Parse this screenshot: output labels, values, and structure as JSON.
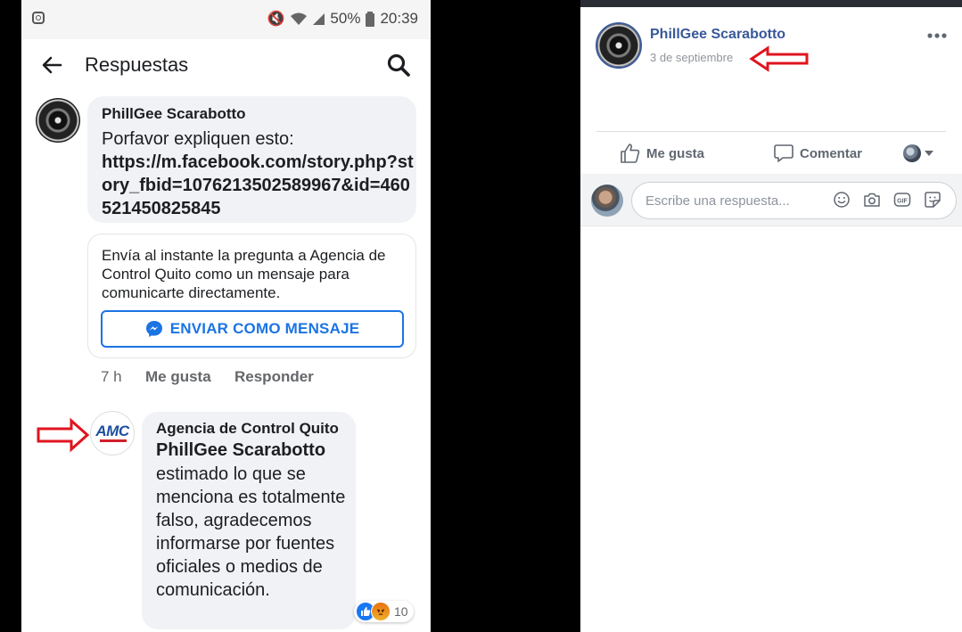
{
  "mobile": {
    "status_bar": {
      "battery": "50%",
      "time": "20:39"
    },
    "app_bar": {
      "title": "Respuestas"
    },
    "comment1": {
      "author": "PhillGee Scarabotto",
      "text": "Porfavor expliquen esto:",
      "link": "https://m.facebook.com/story.php?story_fbid=1076213502589967&id=460521450825845",
      "time": "7 h",
      "like_label": "Me gusta",
      "reply_label": "Responder"
    },
    "ask_card": {
      "text": "Envía al instante la pregunta a Agencia de Control Quito como un mensaje para comunicarte directamente.",
      "button_label": "ENVIAR COMO MENSAJE"
    },
    "comment2": {
      "avatar_text": "AMC",
      "author": "Agencia de Control Quito",
      "mention": "PhillGee Scarabotto",
      "text": "estimado lo que se menciona es totalmente falso, agradecemos informarse por fuentes oficiales o medios de comunicación.",
      "reaction_count": "10",
      "reactions": [
        "like",
        "angry"
      ]
    }
  },
  "desktop": {
    "post": {
      "author": "PhillGee Scarabotto",
      "date": "3 de septiembre"
    },
    "actions": {
      "like_label": "Me gusta",
      "comment_label": "Comentar"
    },
    "reply": {
      "placeholder": "Escribe una respuesta..."
    }
  },
  "colors": {
    "facebook_blue": "#1b74e4",
    "author_blue": "#385898",
    "annotation_red": "#e0141e",
    "bubble_gray": "#f0f2f5"
  },
  "icons": [
    "back-arrow-icon",
    "search-icon",
    "messenger-icon",
    "like-icon",
    "comment-icon",
    "emoji-icon",
    "camera-icon",
    "gif-icon",
    "sticker-icon",
    "more-icon"
  ]
}
